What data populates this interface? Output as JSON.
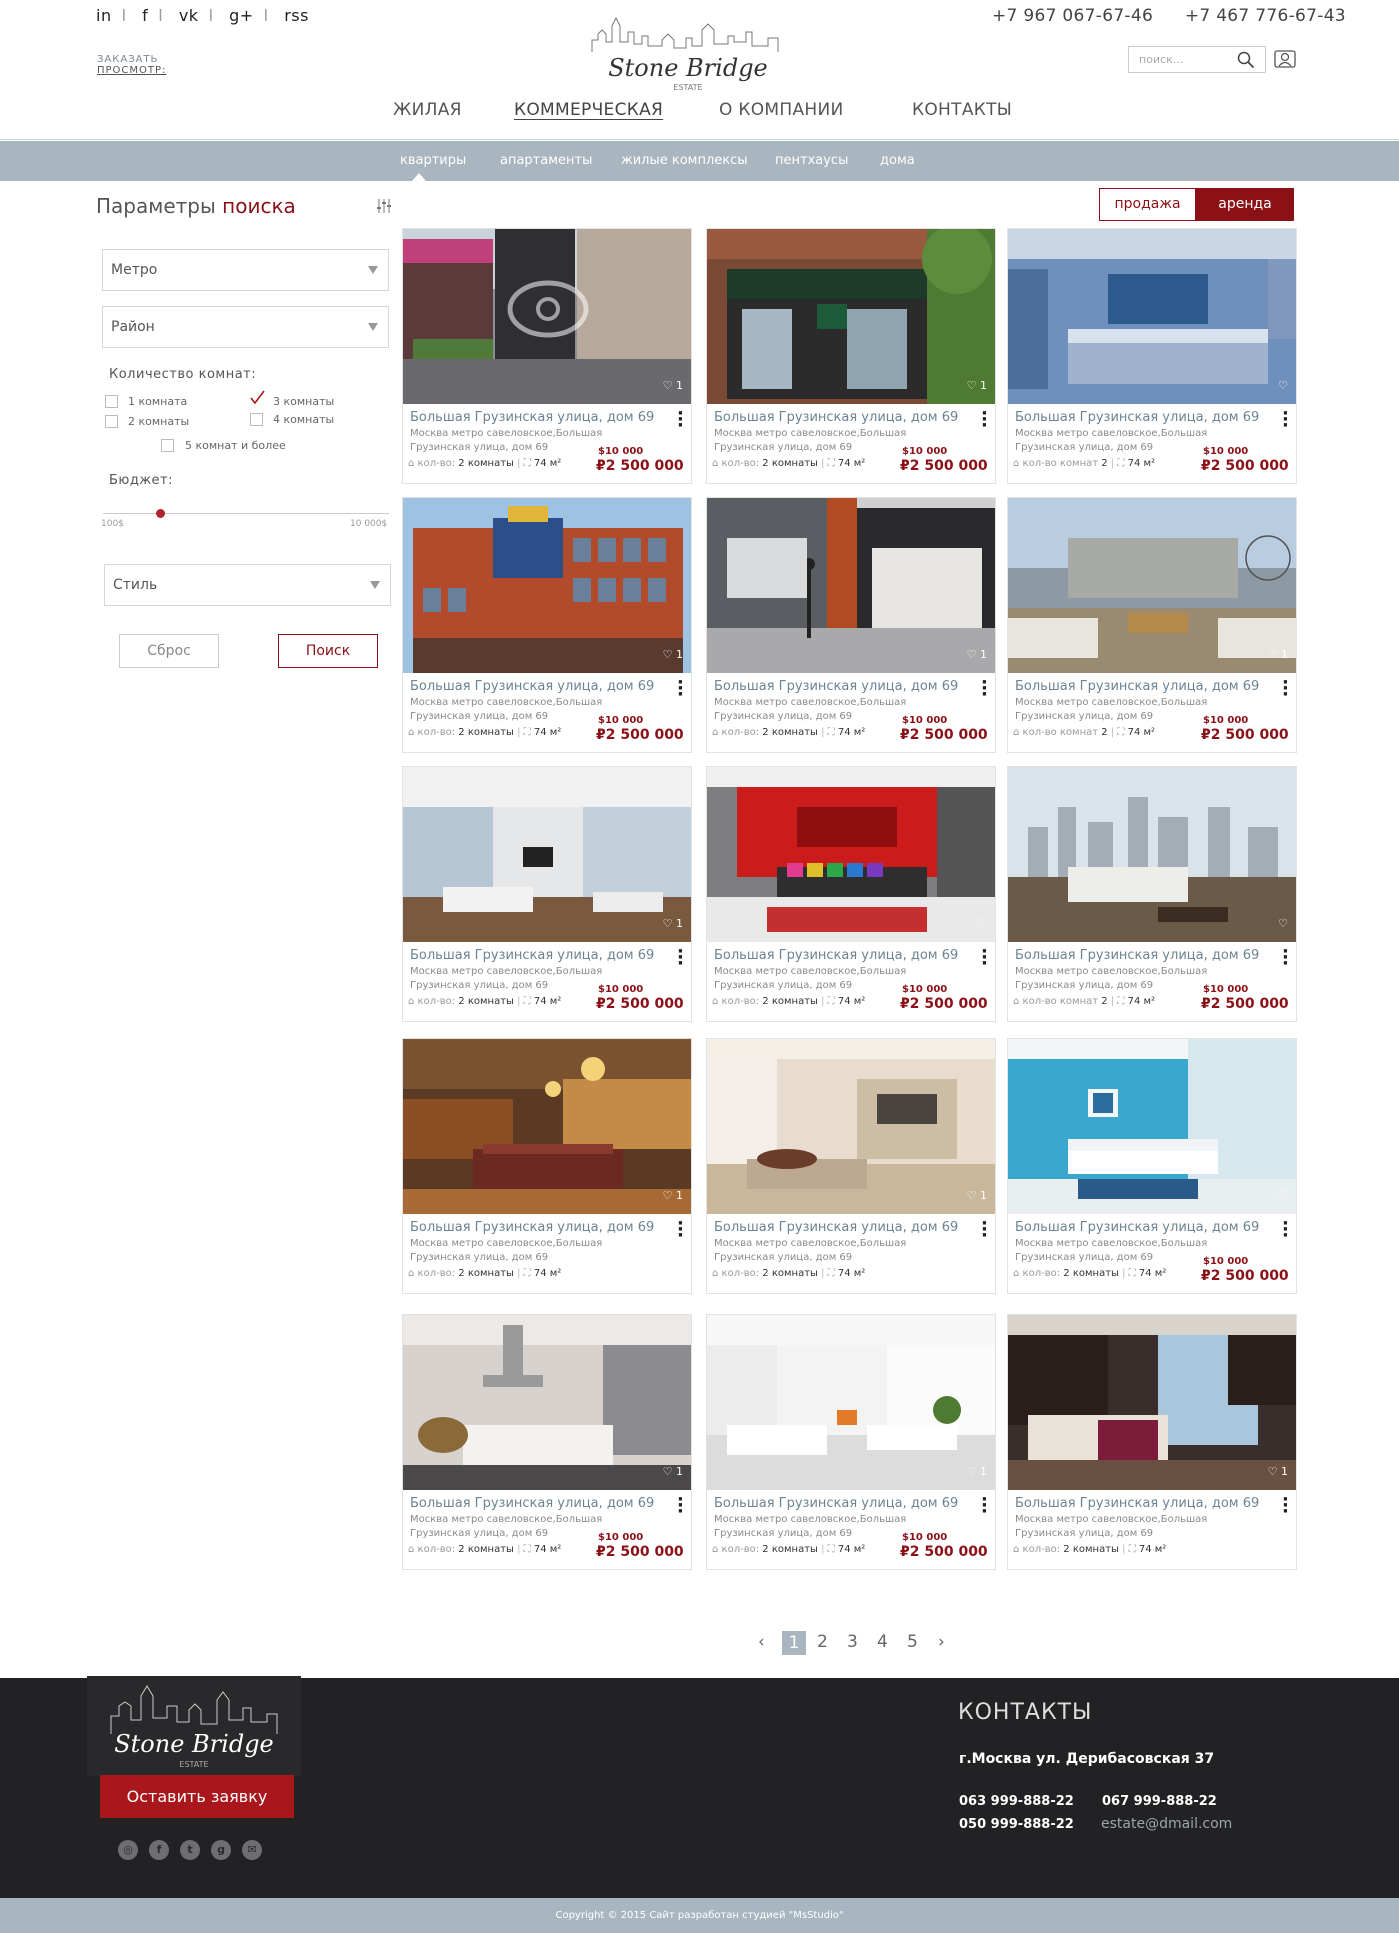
{
  "header": {
    "social": [
      "in",
      "f",
      "vk",
      "g+",
      "rss"
    ],
    "order_label_1": "ЗАКАЗАТЬ",
    "order_label_2": "ПРОСМОТР:",
    "logo_text": "Stone Bridge",
    "logo_sub": "ESTATE",
    "phone_1": "+7 967 067-67-46",
    "phone_2": "+7 467 776-67-43",
    "search_placeholder": "поиск...",
    "nav": [
      "ЖИЛАЯ",
      "КОММЕРЧЕСКАЯ",
      "О КОМПАНИИ",
      "КОНТАКТЫ"
    ],
    "nav_active": "КОММЕРЧЕСКАЯ"
  },
  "subnav": {
    "items": [
      "квартиры",
      "апартаменты",
      "жилые комплексы",
      "пентхаусы",
      "дома"
    ],
    "active": "квартиры"
  },
  "sidebar": {
    "title_a": "Параметры",
    "title_b": "поиска",
    "metro": "Метро",
    "district": "Район",
    "rooms_label": "Количество комнат:",
    "room_options": [
      "1 комната",
      "3 комнаты",
      "2 комнаты",
      "4 комнаты",
      "5 комнат и более"
    ],
    "room_checked": "3 комнаты",
    "budget_label": "Бюджет:",
    "budget_min": "100$",
    "budget_max": "10 000$",
    "budget_value_fraction": 0.2,
    "style": "Стиль",
    "reset_label": "Сброс",
    "search_label": "Поиск"
  },
  "tabs": {
    "sale": "продажа",
    "rent": "аренда",
    "active": "аренда"
  },
  "listings": [
    {
      "title": "Большая Грузинская улица, дом 69",
      "addr1": "Москва метро савеловское,Большая",
      "addr2": "Грузинская улица, дом 69",
      "rooms_label": "кол-во:",
      "rooms": "2 комнаты",
      "area": "74 м²",
      "usd": "$10 000",
      "rub": "₽2 500 000",
      "likes": "1",
      "scene": "street"
    },
    {
      "title": "Большая Грузинская улица, дом 69",
      "addr1": "Москва метро савеловское,Большая",
      "addr2": "Грузинская улица, дом 69",
      "rooms_label": "кол-во:",
      "rooms": "2 комнаты",
      "area": "74 м²",
      "usd": "$10 000",
      "rub": "₽2 500 000",
      "likes": "1",
      "scene": "shop"
    },
    {
      "title": "Большая Грузинская улица, дом 69",
      "addr1": "Москва метро савеловское,Большая",
      "addr2": "Грузинская улица, дом 69",
      "rooms_label": "кол-во комнат",
      "rooms": "2",
      "area": "74 м²",
      "usd": "$10 000",
      "rub": "₽2 500 000",
      "likes": "",
      "scene": "bedroom-blue"
    },
    {
      "title": "Большая Грузинская улица, дом 69",
      "addr1": "Москва метро савеловское,Большая",
      "addr2": "Грузинская улица, дом 69",
      "rooms_label": "кол-во:",
      "rooms": "2 комнаты",
      "area": "74 м²",
      "usd": "$10 000",
      "rub": "₽2 500 000",
      "likes": "1",
      "scene": "building"
    },
    {
      "title": "Большая Грузинская улица, дом 69",
      "addr1": "Москва метро савеловское,Большая",
      "addr2": "Грузинская улица, дом 69",
      "rooms_label": "кол-во:",
      "rooms": "2 комнаты",
      "area": "74 м²",
      "usd": "$10 000",
      "rub": "₽2 500 000",
      "likes": "1",
      "scene": "storefront"
    },
    {
      "title": "Большая Грузинская улица, дом 69",
      "addr1": "Москва метро савеловское,Большая",
      "addr2": "Грузинская улица, дом 69",
      "rooms_label": "кол-во комнат",
      "rooms": "2",
      "area": "74 м²",
      "usd": "$10 000",
      "rub": "₽2 500 000",
      "likes": "1",
      "scene": "terrace"
    },
    {
      "title": "Большая Грузинская улица, дом 69",
      "addr1": "Москва метро савеловское,Большая",
      "addr2": "Грузинская улица, дом 69",
      "rooms_label": "кол-во:",
      "rooms": "2 комнаты",
      "area": "74 м²",
      "usd": "$10 000",
      "rub": "₽2 500 000",
      "likes": "1",
      "scene": "loft"
    },
    {
      "title": "Большая Грузинская улица, дом 69",
      "addr1": "Москва метро савеловское,Большая",
      "addr2": "Грузинская улица, дом 69",
      "rooms_label": "кол-во:",
      "rooms": "2 комнаты",
      "area": "74 м²",
      "usd": "$10 000",
      "rub": "₽2 500 000",
      "likes": "",
      "scene": "red-living"
    },
    {
      "title": "Большая Грузинская улица, дом 69",
      "addr1": "Москва метро савеловское,Большая",
      "addr2": "Грузинская улица, дом 69",
      "rooms_label": "кол-во комнат",
      "rooms": "2",
      "area": "74 м²",
      "usd": "$10 000",
      "rub": "₽2 500 000",
      "likes": "",
      "scene": "city-view"
    },
    {
      "title": "Большая Грузинская улица, дом 69",
      "addr1": "Москва метро савеловское,Большая",
      "addr2": "Грузинская улица, дом 69",
      "rooms_label": "кол-во:",
      "rooms": "2 комнаты",
      "area": "74 м²",
      "usd": "",
      "rub": "",
      "likes": "1",
      "scene": "dining"
    },
    {
      "title": "Большая Грузинская улица, дом 69",
      "addr1": "Москва метро савеловское,Большая",
      "addr2": "Грузинская улица, дом 69",
      "rooms_label": "кол-во:",
      "rooms": "2 комнаты",
      "area": "74 м²",
      "usd": "",
      "rub": "",
      "likes": "1",
      "scene": "beige"
    },
    {
      "title": "Большая Грузинская улица, дом 69",
      "addr1": "Москва метро савеловское,Большая",
      "addr2": "Грузинская улица, дом 69",
      "rooms_label": "кол-во:",
      "rooms": "2 комнаты",
      "area": "74 м²",
      "usd": "$10 000",
      "rub": "₽2 500 000",
      "likes": "",
      "scene": "turquoise"
    },
    {
      "title": "Большая Грузинская улица, дом 69",
      "addr1": "Москва метро савеловское,Большая",
      "addr2": "Грузинская улица, дом 69",
      "rooms_label": "кол-во:",
      "rooms": "2 комнаты",
      "area": "74 м²",
      "usd": "$10 000",
      "rub": "₽2 500 000",
      "likes": "1",
      "scene": "kitchen"
    },
    {
      "title": "Большая Грузинская улица, дом 69",
      "addr1": "Москва метро савеловское,Большая",
      "addr2": "Грузинская улица, дом 69",
      "rooms_label": "кол-во:",
      "rooms": "2 комнаты",
      "area": "74 м²",
      "usd": "$10 000",
      "rub": "₽2 500 000",
      "likes": "1",
      "scene": "white"
    },
    {
      "title": "Большая Грузинская улица, дом 69",
      "addr1": "Москва метро савеловское,Большая",
      "addr2": "Грузинская улица, дом 69",
      "rooms_label": "кол-во:",
      "rooms": "2 комнаты",
      "area": "74 м²",
      "usd": "",
      "rub": "",
      "likes": "1",
      "scene": "bedroom-dark"
    }
  ],
  "pagination": {
    "pages": [
      "1",
      "2",
      "3",
      "4",
      "5"
    ],
    "current": "1"
  },
  "footer": {
    "logo_text": "Stone Bridge",
    "logo_sub": "ESTATE",
    "cta": "Оставить заявку",
    "contacts_title": "КОНТАКТЫ",
    "address": "г.Москва  ул. Дерибасовская 37",
    "phones": [
      "063 999-888-22",
      "050 999-888-22",
      "067 999-888-22"
    ],
    "email": "estate@dmail.com",
    "social_icons": [
      "instagram-icon",
      "facebook-icon",
      "twitter-icon",
      "googleplus-icon",
      "mail-icon"
    ],
    "copyright": "Copyright © 2015  Сайт разработан студией \"MsStudio\""
  },
  "colors": {
    "accent": "#8b1117",
    "bar": "#a9b6bf",
    "footer": "#222224",
    "link": "#6b8393"
  }
}
